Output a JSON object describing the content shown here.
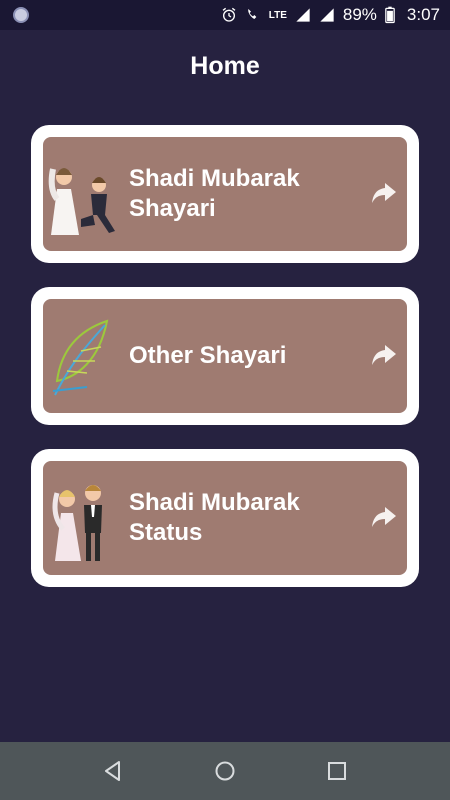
{
  "status_bar": {
    "battery": "89%",
    "time": "3:07",
    "network": "LTE",
    "icons": [
      "app-notification-icon",
      "alarm-icon",
      "wifi-calling-icon",
      "signal-icon",
      "battery-icon"
    ]
  },
  "header": {
    "title": "Home"
  },
  "cards": [
    {
      "label": "Shadi Mubarak Shayari",
      "illustration": "proposal-couple-illustration",
      "icon": "share-arrow-icon"
    },
    {
      "label": "Other Shayari",
      "illustration": "feather-illustration",
      "icon": "share-arrow-icon"
    },
    {
      "label": "Shadi Mubarak Status",
      "illustration": "bride-groom-illustration",
      "icon": "share-arrow-icon"
    }
  ],
  "nav_bar": {
    "buttons": [
      "back-icon",
      "home-icon",
      "recents-icon"
    ]
  },
  "colors": {
    "background": "#262240",
    "card_outer": "#ffffff",
    "card_inner": "#9f7b71",
    "nav_bar": "#4f5659"
  }
}
